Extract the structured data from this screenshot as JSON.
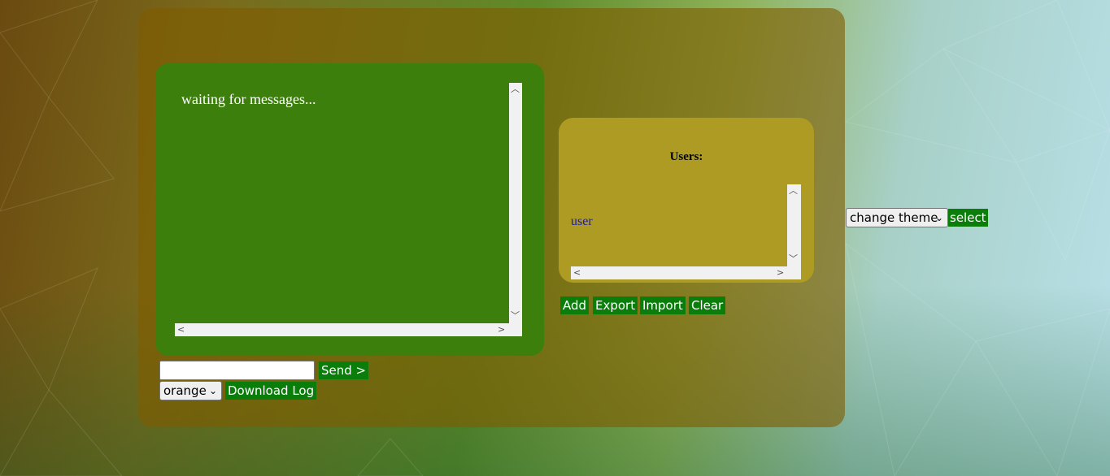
{
  "chat": {
    "status_message": "waiting for messages...",
    "send_label": "Send >",
    "message_input_value": "",
    "color_select_value": "orange",
    "download_label": "Download Log"
  },
  "users": {
    "title": "Users:",
    "list": [
      "user"
    ],
    "add_label": "Add",
    "export_label": "Export",
    "import_label": "Import",
    "clear_label": "Clear"
  },
  "theme": {
    "select_value": "change theme",
    "select_button_label": "select"
  },
  "colors": {
    "button_green": "#0b7d0b",
    "message_box_green": "#3d7f0c",
    "users_box": "#ad9b23",
    "user_name": "#1d1aa8"
  }
}
